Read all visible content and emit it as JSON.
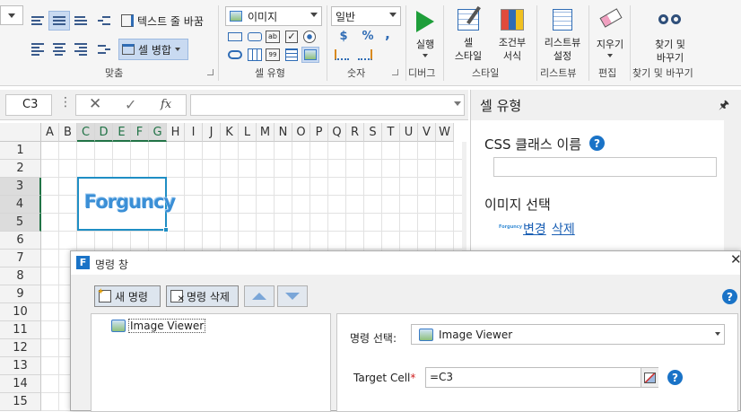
{
  "ribbon": {
    "alignment": {
      "wrap_text": "텍스트 줄 바꿈",
      "merge_cells": "셀 병합",
      "group_label": "맞춤"
    },
    "cell_type": {
      "combo_value": "이미지",
      "group_label": "셀 유형"
    },
    "number": {
      "format_value": "일반",
      "currency": "$",
      "percent": "%",
      "comma": ",",
      "group_label": "숫자"
    },
    "debug": {
      "run_label": "실행",
      "group_label": "디버그"
    },
    "style": {
      "cell_style_line1": "셀",
      "cell_style_line2": "스타일",
      "cond_format_line1": "조건부",
      "cond_format_line2": "서식",
      "group_label": "스타일"
    },
    "listview": {
      "settings_line1": "리스트뷰",
      "settings_line2": "설정",
      "group_label": "리스트뷰"
    },
    "edit": {
      "clear_label": "지우기",
      "group_label": "편집"
    },
    "find": {
      "find_line1": "찾기 및",
      "find_line2": "바꾸기",
      "group_label": "찾기 및 바꾸기"
    }
  },
  "formula_bar": {
    "name_box": "C3",
    "fx": "fx",
    "formula": ""
  },
  "grid": {
    "columns": [
      "A",
      "B",
      "C",
      "D",
      "E",
      "F",
      "G",
      "H",
      "I",
      "J",
      "K",
      "L",
      "M",
      "N",
      "O",
      "P",
      "Q",
      "R",
      "S",
      "T",
      "U",
      "V",
      "W"
    ],
    "rows": [
      "1",
      "2",
      "3",
      "4",
      "5",
      "6",
      "7",
      "8",
      "9",
      "10",
      "11",
      "12",
      "13",
      "14",
      "15"
    ],
    "image_text": "Forguncy"
  },
  "panel": {
    "title": "셀 유형",
    "css_class_label": "CSS 클래스 이름",
    "css_class_value": "",
    "image_select_label": "이미지 선택",
    "thumb_text": "Forguncy",
    "change_link": "변경",
    "delete_link": "삭제"
  },
  "dialog": {
    "icon_letter": "F",
    "title": "명령 창",
    "new_command": "새 명령",
    "delete_command": "명령 삭제",
    "tree_item": "Image Viewer",
    "select_label": "명령 선택:",
    "select_value": "Image Viewer",
    "target_label": "Target Cell",
    "target_required": "*",
    "target_value": "=C3"
  },
  "colors": {
    "accent_green": "#217346",
    "link_blue": "#1a5fb4",
    "help_blue": "#1a73c7",
    "run_green": "#1e9e3a"
  }
}
